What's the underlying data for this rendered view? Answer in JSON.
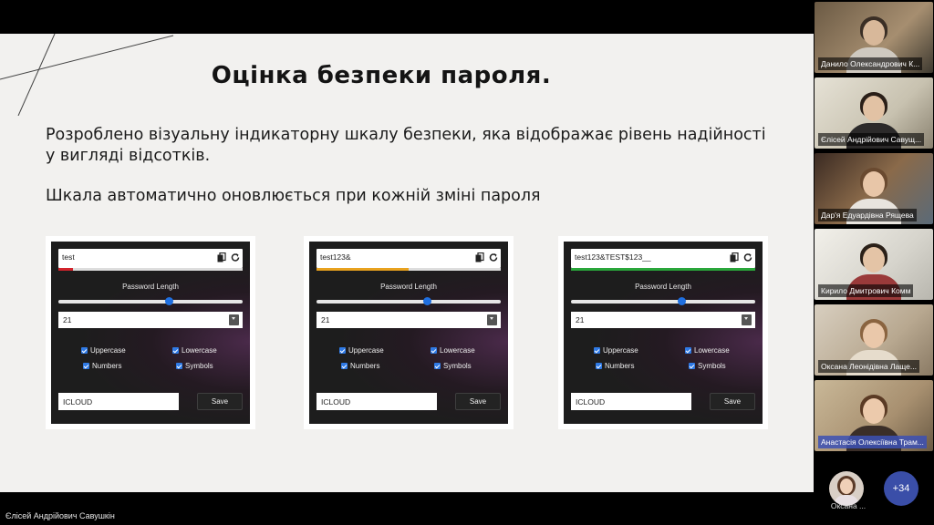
{
  "slide": {
    "title": "Оцінка безпеки пароля.",
    "line1": "Розроблено візуальну індикаторну шкалу безпеки, яка відображає рівень надійності",
    "line2": "у вигляді відсотків.",
    "line3": "Шкала автоматично оновлюється при кожній зміні пароля"
  },
  "cards": [
    {
      "password": "test",
      "strength_percent": 8,
      "strength_color": "#d2242c",
      "length_label": "Password Length",
      "slider_fraction": 0.6,
      "length_value": "21",
      "options": {
        "uppercase": "Uppercase",
        "lowercase": "Lowercase",
        "numbers": "Numbers",
        "symbols": "Symbols"
      },
      "name_value": "ICLOUD",
      "save_label": "Save"
    },
    {
      "password": "test123&",
      "strength_percent": 50,
      "strength_color": "#e8a21f",
      "length_label": "Password Length",
      "slider_fraction": 0.6,
      "length_value": "21",
      "options": {
        "uppercase": "Uppercase",
        "lowercase": "Lowercase",
        "numbers": "Numbers",
        "symbols": "Symbols"
      },
      "name_value": "ICLOUD",
      "save_label": "Save"
    },
    {
      "password": "test123&TEST$123__",
      "strength_percent": 100,
      "strength_color": "#2aa63b",
      "length_label": "Password Length",
      "slider_fraction": 0.6,
      "length_value": "21",
      "options": {
        "uppercase": "Uppercase",
        "lowercase": "Lowercase",
        "numbers": "Numbers",
        "symbols": "Symbols"
      },
      "name_value": "ICLOUD",
      "save_label": "Save"
    }
  ],
  "participants": [
    {
      "name": "Данило Олександрович К..."
    },
    {
      "name": "Єлісей Андрійович Савущ..."
    },
    {
      "name": "Дар'я Едуардівна Рящева"
    },
    {
      "name": "Кирило Дмитрович Комм"
    },
    {
      "name": "Оксана Леонідівна Лаще..."
    },
    {
      "name": "Анастасія Олексіївна Трам..."
    }
  ],
  "footer": {
    "avatar_label": "Оксана ...",
    "more_count": "+34",
    "speaker": "Єлісей Андрійович Савушкін"
  },
  "colors": {
    "slide_bg": "#f2f1ef",
    "accent": "#3a4ea8"
  }
}
